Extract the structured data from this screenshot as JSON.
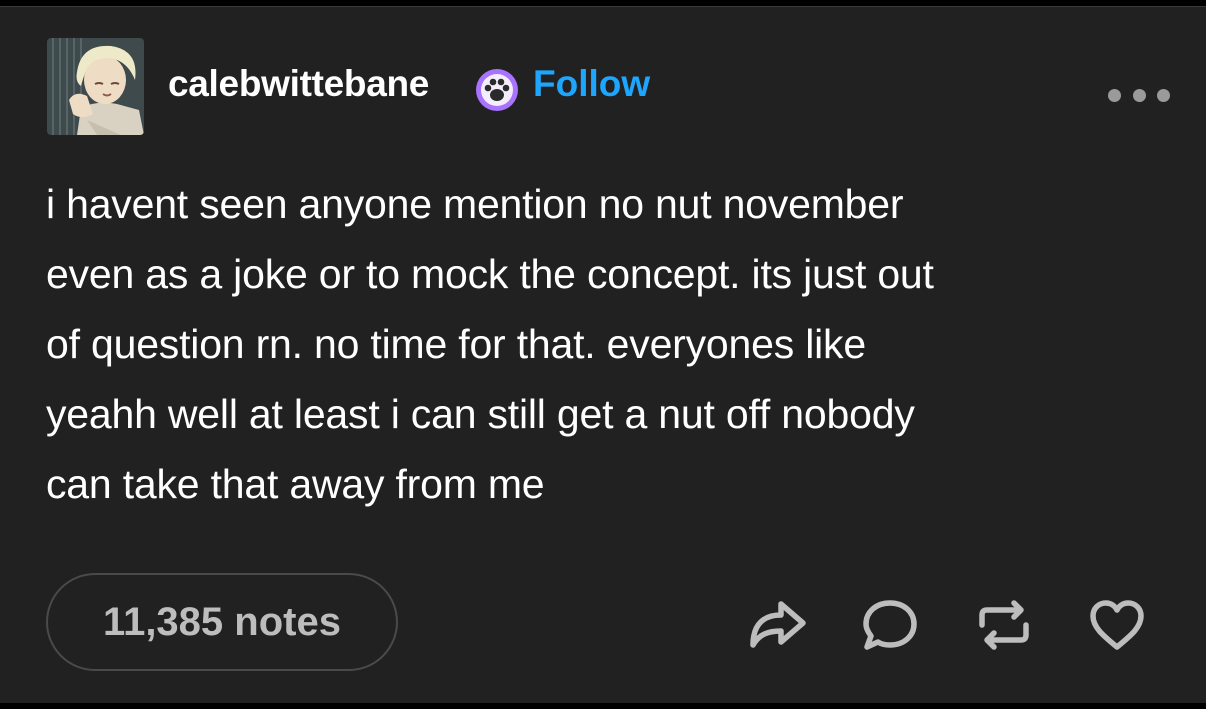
{
  "post": {
    "author": {
      "username": "calebwittebane",
      "badge_icon": "paw-badge-icon",
      "follow_label": "Follow",
      "follow_color": "#1ea6ff"
    },
    "more_icon": "ellipsis-icon",
    "text_lines": [
      "i havent seen anyone mention no nut november",
      "even as a joke or to mock the concept. its just out",
      "of question rn. no time for that. everyones like",
      "yeahh well at least i can still get a nut off nobody",
      "can take that away from me"
    ],
    "notes_label": "11,385 notes",
    "actions": [
      {
        "icon": "share-icon"
      },
      {
        "icon": "reply-icon"
      },
      {
        "icon": "reblog-icon"
      },
      {
        "icon": "like-icon"
      }
    ]
  },
  "colors": {
    "background": "#212121",
    "text": "#ffffff",
    "icon": "#bdbdbd",
    "accent": "#1ea6ff"
  }
}
